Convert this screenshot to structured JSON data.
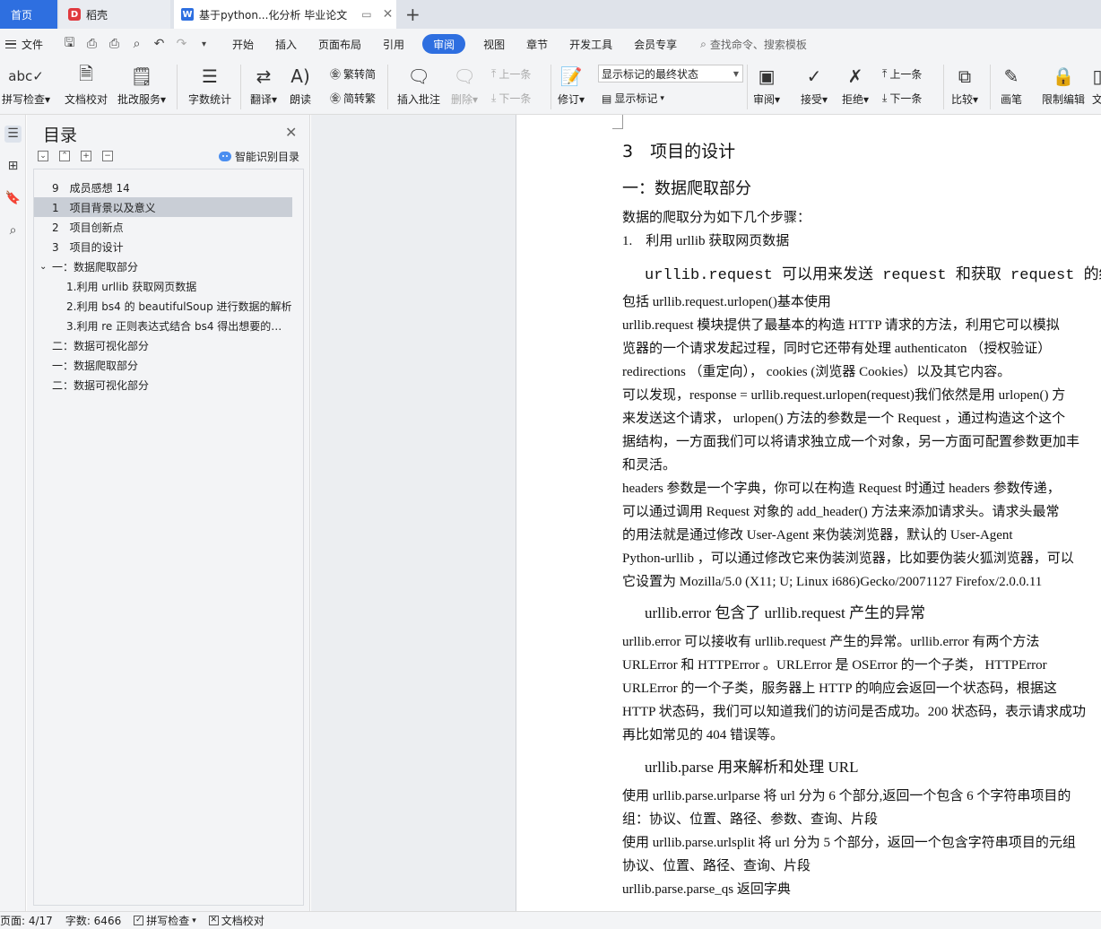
{
  "tabs": {
    "home": "首页",
    "daoke": "稻壳",
    "doc": "基于python...化分析 毕业论文"
  },
  "menu": {
    "file": "文件",
    "items": [
      "开始",
      "插入",
      "页面布局",
      "引用",
      "审阅",
      "视图",
      "章节",
      "开发工具",
      "会员专享"
    ],
    "active": "审阅",
    "search": "查找命令、搜索模板"
  },
  "ribbon": {
    "spell_check": "拼写检查",
    "doc_proof": "文档校对",
    "batch_service": "批改服务",
    "word_count": "字数统计",
    "translate": "翻译",
    "read_aloud": "朗读",
    "trad_to_simp": "繁转简",
    "simp_to_trad": "简转繁",
    "insert_comment": "插入批注",
    "delete": "删除",
    "prev_comment": "上一条",
    "next_comment": "下一条",
    "track_changes": "修订",
    "markup_state": "显示标记的最终状态",
    "show_markup": "显示标记",
    "review": "审阅",
    "accept": "接受",
    "reject": "拒绝",
    "prev_change": "上一条",
    "next_change": "下一条",
    "compare": "比较",
    "ink": "画笔",
    "restrict_edit": "限制编辑",
    "doc_cut": "文"
  },
  "toc": {
    "title": "目录",
    "smart": "智能识别目录",
    "items": [
      {
        "label": "9　成员感想 14",
        "level": 1
      },
      {
        "label": "1　项目背景以及意义",
        "level": 1,
        "selected": true
      },
      {
        "label": "2　项目创新点",
        "level": 1
      },
      {
        "label": "3　项目的设计",
        "level": 1
      },
      {
        "label": "一：数据爬取部分",
        "level": 1,
        "expanded": true
      },
      {
        "label": "1.利用 urllib 获取网页数据",
        "level": 2
      },
      {
        "label": "2.利用 bs4 的 beautifulSoup 进行数据的解析",
        "level": 2
      },
      {
        "label": "3.利用 re 正则表达式结合 bs4 得出想要的数据",
        "level": 2
      },
      {
        "label": "二：数据可视化部分",
        "level": 1
      },
      {
        "label": "一：数据爬取部分",
        "level": 1
      },
      {
        "label": "二：数据可视化部分",
        "level": 1
      }
    ]
  },
  "doc": {
    "heading": "3　项目的设计",
    "section1": "一：数据爬取部分",
    "intro": "数据的爬取分为如下几个步骤：",
    "step1": "1.　利用 urllib 获取网页数据",
    "code_line": "urllib.request 可以用来发送 request 和获取 request 的结果",
    "p1": "包括 urllib.request.urlopen()基本使用",
    "p2": "urllib.request 模块提供了最基本的构造 HTTP 请求的方法，利用它可以模拟",
    "p3": "览器的一个请求发起过程，同时它还带有处理 authenticaton （授权验证）",
    "p4": "redirections （重定向）， cookies (浏览器 Cookies）以及其它内容。",
    "p5": "可以发现，response = urllib.request.urlopen(request)我们依然是用 urlopen() 方",
    "p6": "来发送这个请求， urlopen() 方法的参数是一个 Request ，通过构造这个这个",
    "p7": "据结构，一方面我们可以将请求独立成一个对象，另一方面可配置参数更加丰",
    "p8": "和灵活。",
    "p9": "headers 参数是一个字典，你可以在构造 Request 时通过 headers 参数传递，",
    "p10": "可以通过调用 Request 对象的 add_header() 方法来添加请求头。请求头最常",
    "p11": "的用法就是通过修改 User-Agent 来伪装浏览器，默认的 User-Agent",
    "p12": "Python-urllib ，可以通过修改它来伪装浏览器，比如要伪装火狐浏览器，可以",
    "p13": "它设置为 Mozilla/5.0 (X11; U; Linux i686)Gecko/20071127 Firefox/2.0.0.11",
    "h_error": "urllib.error 包含了 urllib.request 产生的异常",
    "e1": " urllib.error 可以接收有 urllib.request 产生的异常。urllib.error 有两个方法",
    "e2": "URLError 和 HTTPError 。URLError 是 OSError 的一个子类， HTTPError",
    "e3": "URLError 的一个子类，服务器上 HTTP 的响应会返回一个状态码，根据这",
    "e4": "HTTP 状态码，我们可以知道我们的访问是否成功。200 状态码，表示请求成功",
    "e5": "再比如常见的 404 错误等。",
    "h_parse": "urllib.parse 用来解析和处理 URL",
    "u1": "使用 urllib.parse.urlparse 将 url 分为 6 个部分,返回一个包含 6 个字符串项目的",
    "u2": "组：协议、位置、路径、参数、查询、片段",
    "u3": "使用 urllib.parse.urlsplit 将 url 分为 5 个部分，返回一个包含字符串项目的元组",
    "u4": "协议、位置、路径、查询、片段",
    "u5": "urllib.parse.parse_qs 返回字典"
  },
  "status": {
    "page": "页面: 4/17",
    "words": "字数: 6466",
    "spell": "拼写检查",
    "proof": "文档校对"
  },
  "colors": {
    "accent": "#2e6fe0",
    "selected_toc": "#c9ced6",
    "squiggle": "#c03030"
  }
}
